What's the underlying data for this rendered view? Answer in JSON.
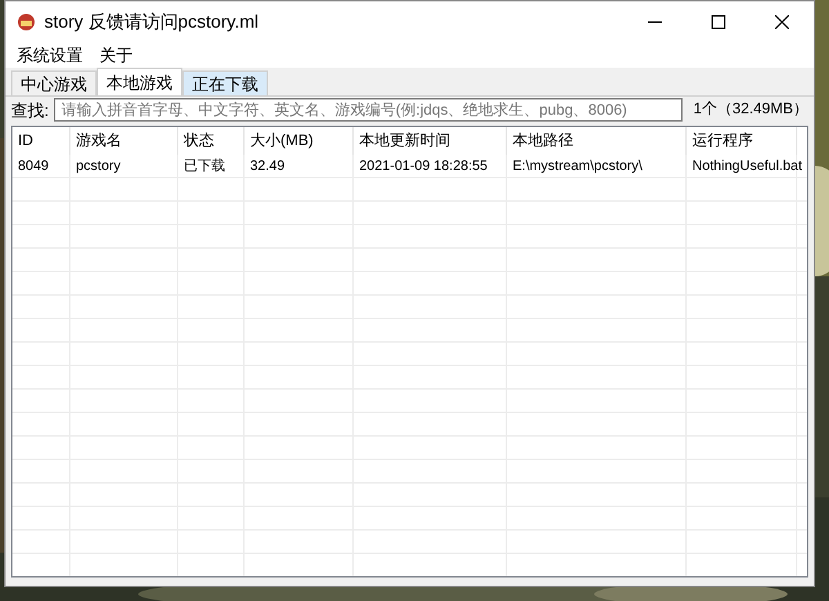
{
  "window": {
    "title": "story 反馈请访问pcstory.ml"
  },
  "menu": [
    "系统设置",
    "关于"
  ],
  "tabs": [
    {
      "label": "中心游戏",
      "selected": false,
      "hovered": false
    },
    {
      "label": "本地游戏",
      "selected": true,
      "hovered": false
    },
    {
      "label": "正在下载",
      "selected": false,
      "hovered": true
    }
  ],
  "search": {
    "label": "查找:",
    "placeholder": "请输入拼音首字母、中文字符、英文名、游戏编号(例:jdqs、绝地求生、pubg、8006)",
    "summary": "1个（32.49MB）"
  },
  "table": {
    "columns": [
      "ID",
      "游戏名",
      "状态",
      "大小(MB)",
      "本地更新时间",
      "本地路径",
      "运行程序"
    ],
    "rows": [
      [
        "8049",
        "pcstory",
        "已下载",
        "32.49",
        "2021-01-09 18:28:55",
        "E:\\mystream\\pcstory\\",
        "NothingUseful.bat"
      ]
    ]
  }
}
